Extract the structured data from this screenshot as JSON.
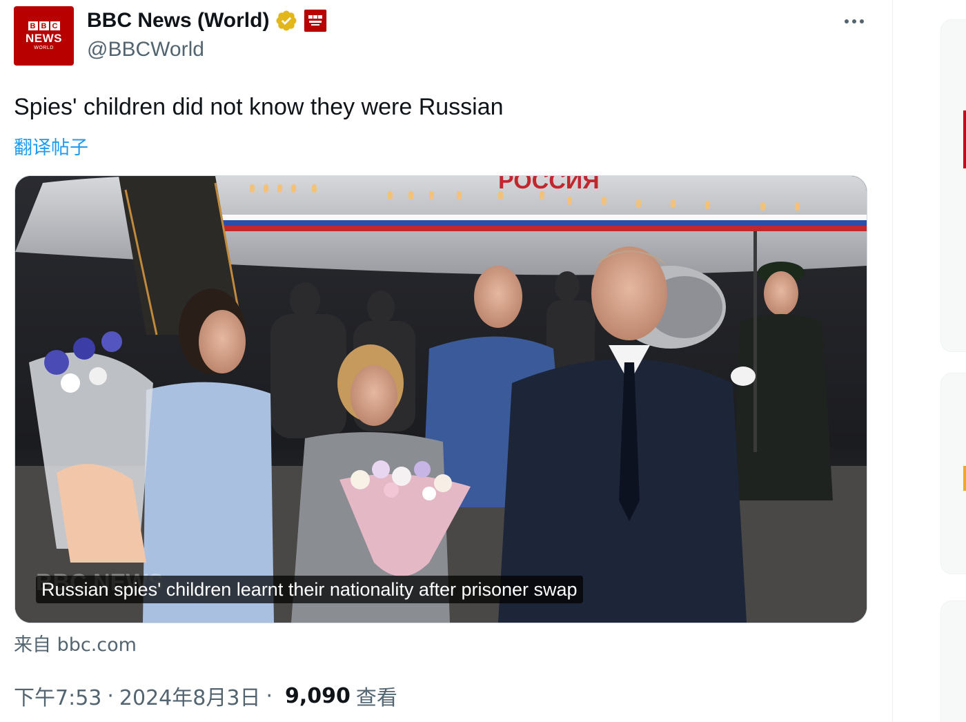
{
  "tweet": {
    "avatar": {
      "blocks": [
        "B",
        "B",
        "C"
      ],
      "news": "NEWS",
      "world": "WORLD"
    },
    "display_name": "BBC News (World)",
    "handle": "@BBCWorld",
    "text": "Spies' children did not know they were Russian",
    "translate_label": "翻译帖子",
    "media_caption": "Russian spies' children learnt their nationality after prisoner swap",
    "source": "来自 bbc.com",
    "time": "下午7:53",
    "date": "2024年8月3日",
    "views_count": "9,090",
    "views_label": "查看",
    "separator": "·"
  },
  "image_text": {
    "plane_lettering": "РОССИЯ",
    "watermark": "BBC NEWS"
  },
  "icons": {
    "verified": "verified-badge-icon",
    "affiliate": "bbc-news-affiliate-badge-icon",
    "more": "more-options-icon"
  },
  "colors": {
    "brand": "#b80000",
    "link": "#1d9bf0",
    "secondary_text": "#536471",
    "verified_gold": "#e2b719",
    "sidebar_accent": "#d0021b"
  }
}
